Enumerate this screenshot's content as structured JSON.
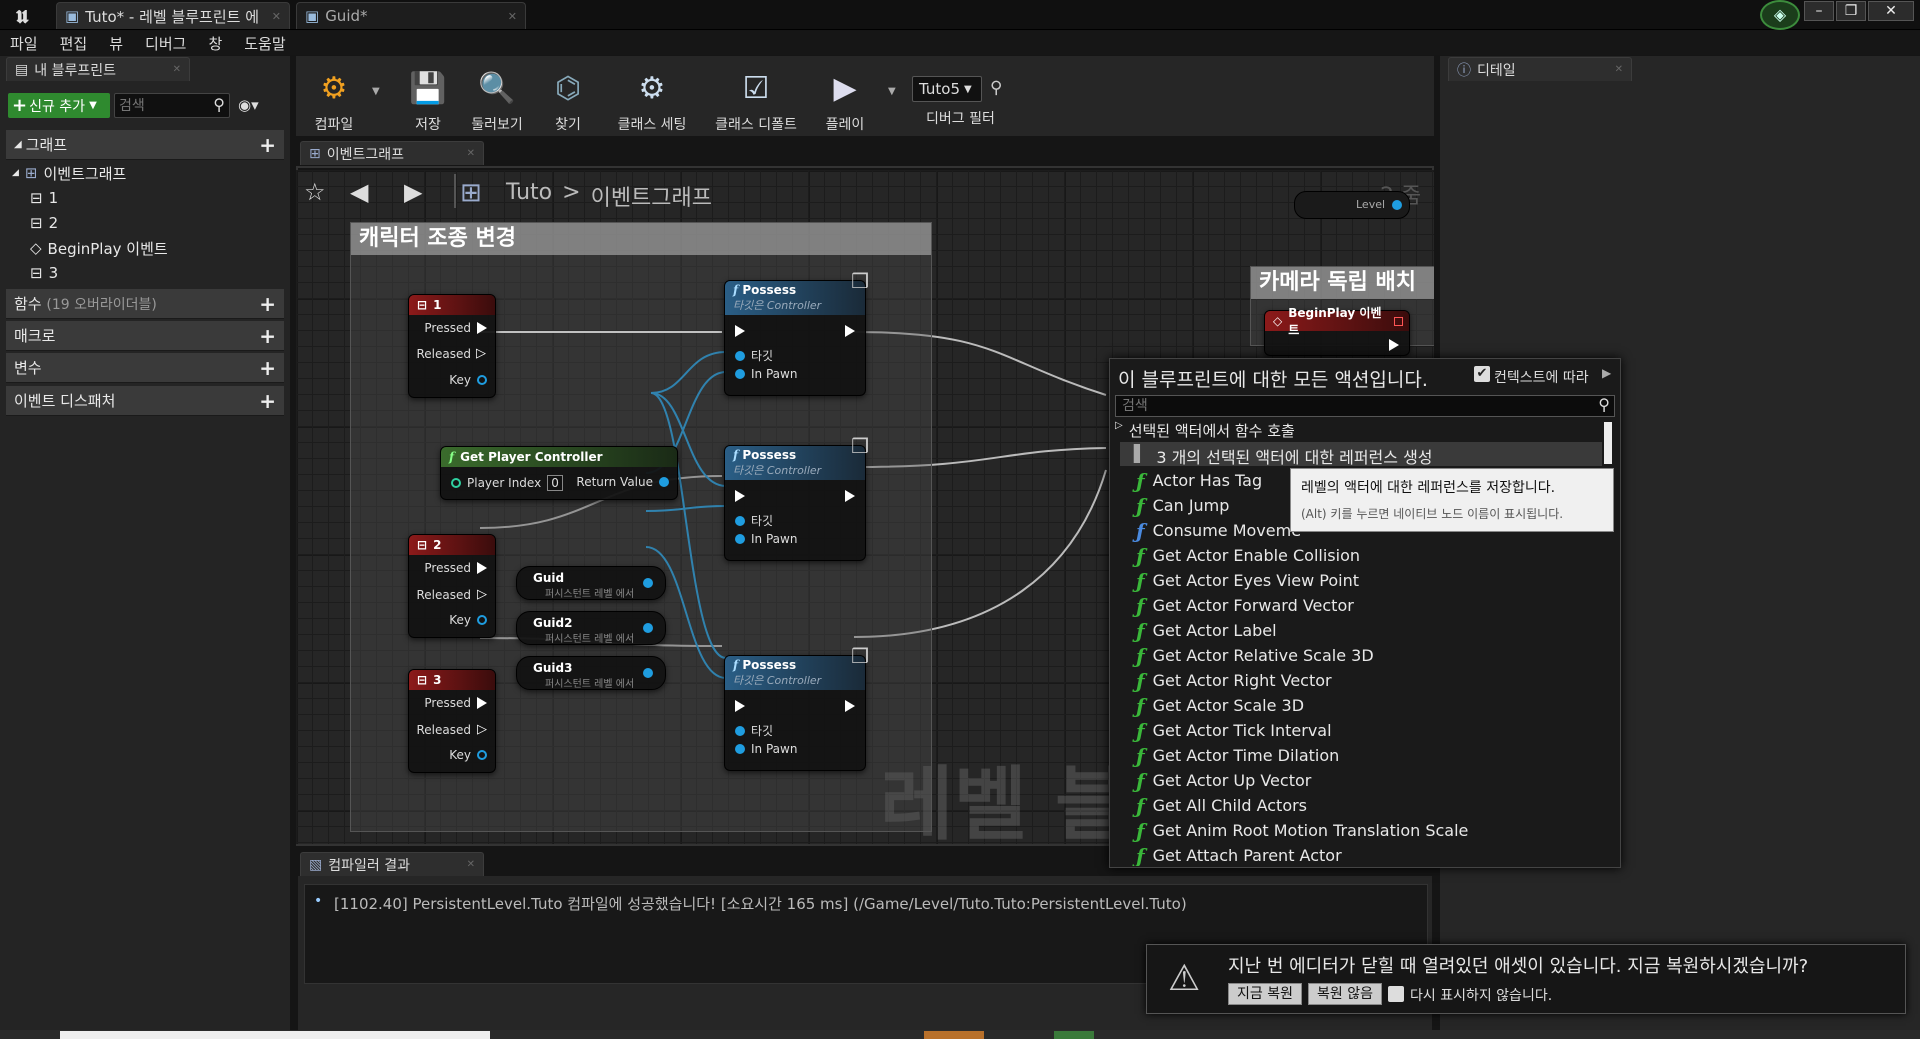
{
  "window": {
    "tab1": "Tuto* - 레벨 블루프린트 에",
    "tab2": "Guid*"
  },
  "menu": [
    "파일",
    "편집",
    "뷰",
    "디버그",
    "창",
    "도움말"
  ],
  "my_blueprint": {
    "tab": "내 블루프린트",
    "add_new": "신규 추가",
    "search_placeholder": "검색",
    "graph_cat": "그래프",
    "event_graph": "이벤트그래프",
    "items": [
      "1",
      "2",
      "BeginPlay 이벤트",
      "3"
    ],
    "functions": "함수",
    "functions_count": "(19 오버라이더블)",
    "macros": "매크로",
    "variables": "변수",
    "dispatchers": "이벤트 디스패처"
  },
  "toolbar": {
    "compile": "컴파일",
    "save": "저장",
    "browse": "둘러보기",
    "find": "찾기",
    "class_settings": "클래스 세팅",
    "class_defaults": "클래스 디폴트",
    "play": "플레이",
    "debug_object": "Tuto5",
    "debug_filter": "디버그 필터"
  },
  "graph": {
    "tab": "이벤트그래프",
    "breadcrumb_root": "Tuto",
    "breadcrumb_sep": ">",
    "breadcrumb_leaf": "이벤트그래프",
    "zoom": "-2 줌",
    "level_pin": "Level",
    "watermark": "레벨 블",
    "comment1": "캐릭터 조종 변경",
    "comment2": "카메라 독립 배치",
    "key1": "1",
    "key2": "2",
    "key3": "3",
    "pressed": "Pressed",
    "released": "Released",
    "key": "Key",
    "possess": "Possess",
    "possess_sub": "타깃은 Controller",
    "target": "타깃",
    "in_pawn": "In Pawn",
    "gpc": "Get Player Controller",
    "player_index": "Player Index",
    "player_index_val": "0",
    "return_value": "Return Value",
    "guid": "Guid",
    "guid2": "Guid2",
    "guid3": "Guid3",
    "guid_sub": "퍼시스턴트 레벨 에서",
    "beginplay": "BeginPlay 이벤트"
  },
  "action_menu": {
    "title": "이 블루프린트에 대한 모든 액션입니다.",
    "context": "컨텍스트에 따라",
    "search_placeholder": "검색",
    "category": "선택된 액터에서 함수 호출",
    "ref_item": "3 개의 선택된 액터에 대한 레퍼런스 생성",
    "items": [
      "Actor Has Tag",
      "Can Jump",
      "Consume Moveme",
      "Get Actor Enable Collision",
      "Get Actor Eyes View Point",
      "Get Actor Forward Vector",
      "Get Actor Label",
      "Get Actor Relative Scale 3D",
      "Get Actor Right Vector",
      "Get Actor Scale 3D",
      "Get Actor Tick Interval",
      "Get Actor Time Dilation",
      "Get Actor Up Vector",
      "Get All Child Actors",
      "Get Anim Root Motion Translation Scale",
      "Get Attach Parent Actor"
    ],
    "tooltip1": "레벨의 액터에 대한 레퍼런스를 저장합니다.",
    "tooltip2": "(Alt) 키를 누르면 네이티브 노드 이름이 표시됩니다."
  },
  "details": {
    "tab": "디테일"
  },
  "compiler": {
    "tab": "컴파일러 결과",
    "log": "[1102.40] PersistentLevel.Tuto 컴파일에 성공했습니다! [소요시간 165 ms] (/Game/Level/Tuto.Tuto:PersistentLevel.Tuto)"
  },
  "notify": {
    "message": "지난 번 에디터가 닫힐 때 열려있던 애셋이 있습니다. 지금 복원하시겠습니까?",
    "restore": "지금 복원",
    "dont_restore": "복원 않음",
    "dont_show": "다시 표시하지 않습니다."
  }
}
